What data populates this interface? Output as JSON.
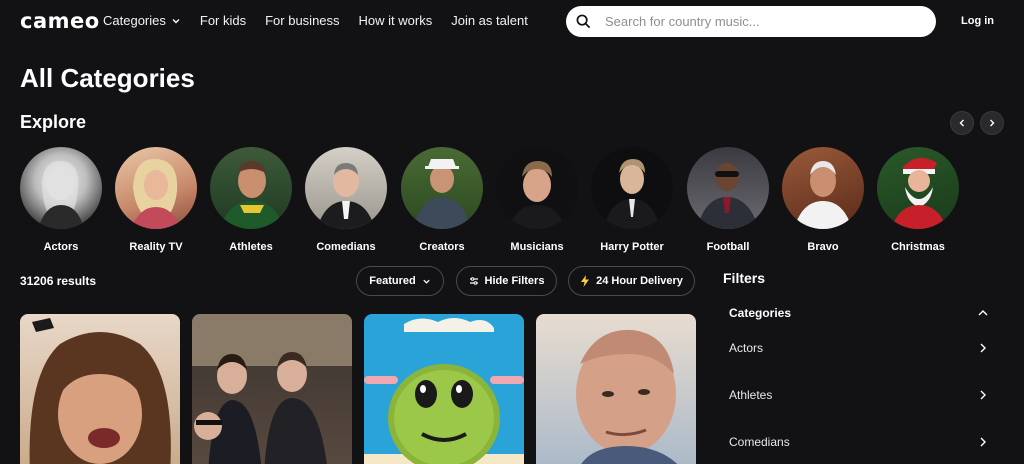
{
  "header": {
    "logo": "cameo",
    "nav": [
      "Categories",
      "For kids",
      "For business",
      "How it works",
      "Join as talent"
    ],
    "search_placeholder": "Search for country music...",
    "login": "Log in"
  },
  "page_title": "All Categories",
  "explore": {
    "title": "Explore",
    "categories": [
      "Actors",
      "Reality TV",
      "Athletes",
      "Comedians",
      "Creators",
      "Musicians",
      "Harry Potter",
      "Football",
      "Bravo",
      "Christmas"
    ]
  },
  "results": {
    "count": "31206 results",
    "sort_label": "Featured",
    "hide_filters_label": "Hide Filters",
    "delivery_label": "24 Hour Delivery"
  },
  "filters": {
    "title": "Filters",
    "categories_label": "Categories",
    "items": [
      "Actors",
      "Athletes",
      "Comedians"
    ]
  },
  "colors": {
    "background": "#121114",
    "accent_bolt": "#f5d33f"
  }
}
